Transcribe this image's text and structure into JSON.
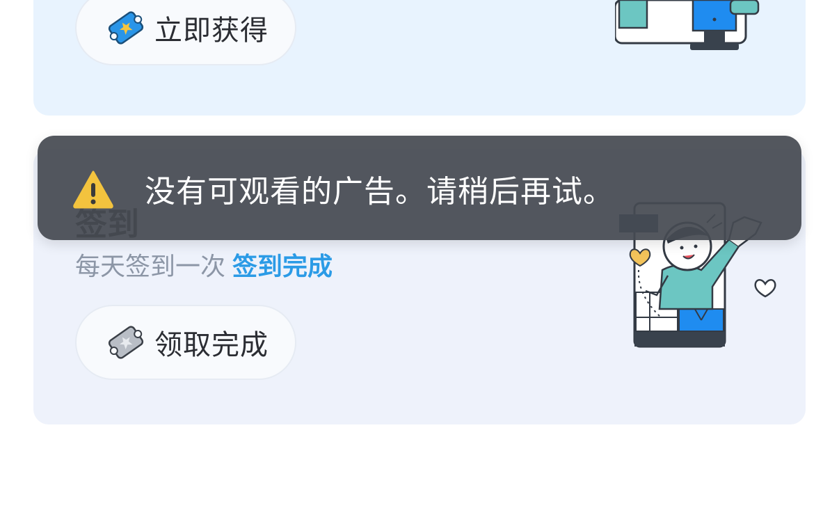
{
  "top_card": {
    "claim_button_label": "立即获得"
  },
  "checkin_card": {
    "title": "签到",
    "description": "每天签到一次",
    "status": "签到完成",
    "claim_button_label": "领取完成"
  },
  "toast": {
    "message": "没有可观看的广告。请稍后再试。"
  },
  "colors": {
    "accent_blue": "#2b9be6",
    "toast_bg": "#464a52",
    "warning_yellow": "#f3c33e",
    "card_top_bg": "#e8f3fe",
    "card_bottom_bg": "#eef2fb"
  }
}
